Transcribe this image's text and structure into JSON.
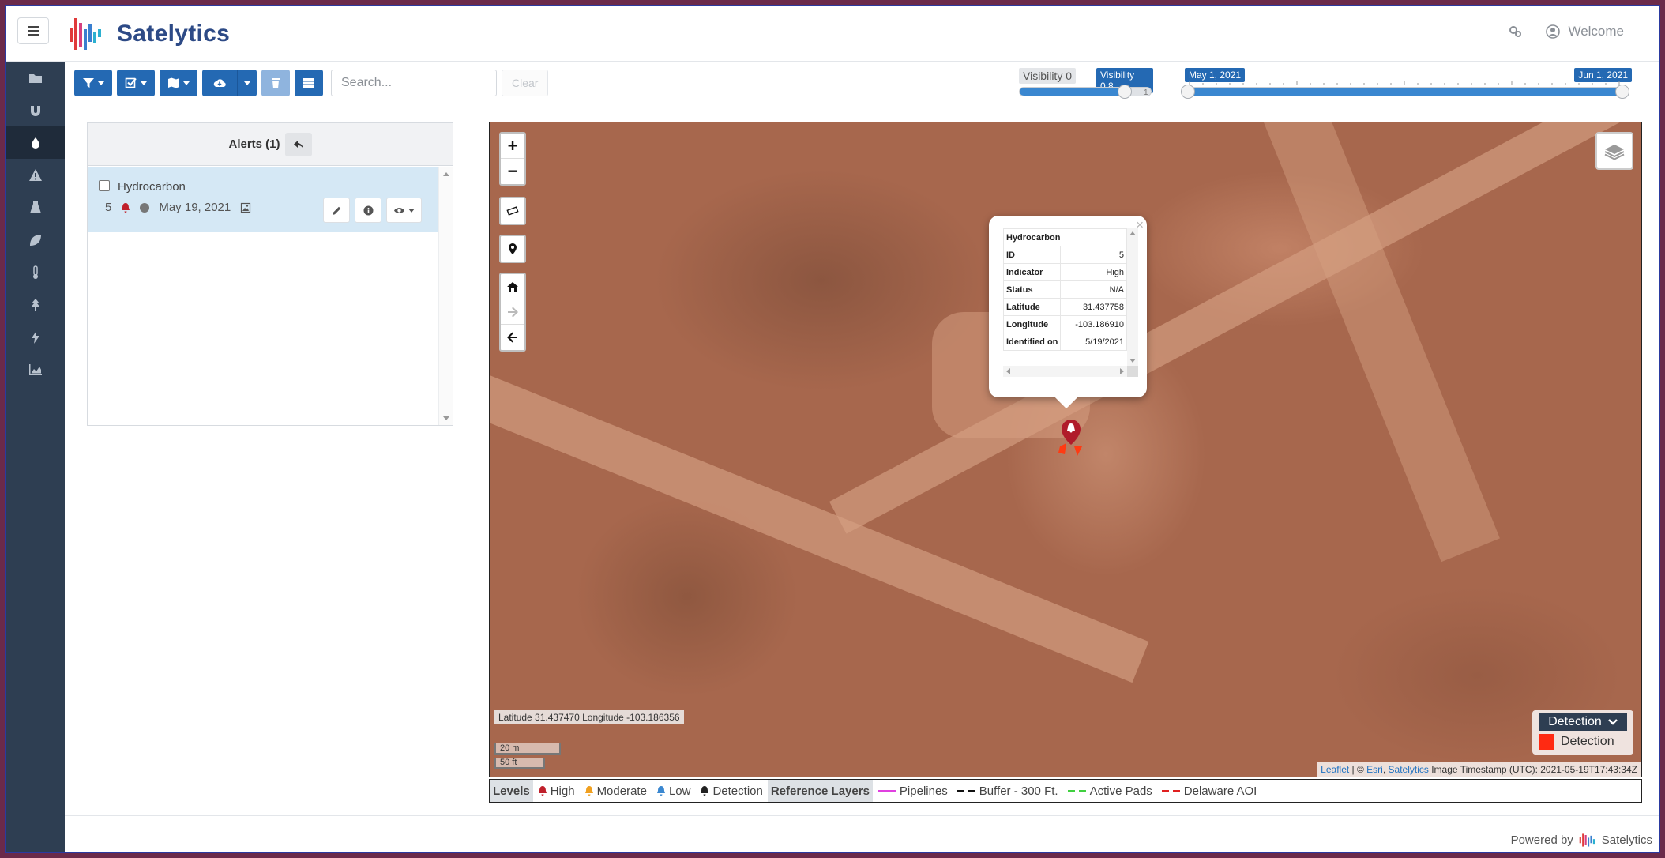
{
  "app": {
    "brand": "Satelytics",
    "welcome": "Welcome"
  },
  "toolbar": {
    "search_placeholder": "Search...",
    "clear_label": "Clear"
  },
  "visibility_slider": {
    "min_label": "Visibility 0",
    "current_label": "Visibility 0.8",
    "max_tick": "1",
    "value": 0.8
  },
  "time_slider": {
    "start_label": "May 1, 2021",
    "end_label": "Jun 1, 2021"
  },
  "alerts_panel": {
    "title": "Alerts (1)",
    "items": [
      {
        "name": "Hydrocarbon",
        "id": "5",
        "date": "May 19, 2021",
        "level": "High"
      }
    ]
  },
  "popup": {
    "title": "Hydrocarbon",
    "rows": [
      {
        "key": "ID",
        "value": "5"
      },
      {
        "key": "Indicator",
        "value": "High"
      },
      {
        "key": "Status",
        "value": "N/A"
      },
      {
        "key": "Latitude",
        "value": "31.437758"
      },
      {
        "key": "Longitude",
        "value": "-103.186910"
      },
      {
        "key": "Identified on",
        "value": "5/19/2021"
      }
    ]
  },
  "map": {
    "coords": "Latitude 31.437470 Longitude -103.186356",
    "scale_metric": "20 m",
    "scale_imperial": "50 ft",
    "legend_title": "Detection",
    "legend_item": "Detection",
    "attribution": {
      "leaflet": "Leaflet",
      "sep": " | © ",
      "esri": "Esri",
      "comma": ", ",
      "satelytics": "Satelytics",
      "timestamp": " Image Timestamp (UTC): 2021-05-19T17:43:34Z"
    }
  },
  "levels_bar": {
    "levels_label": "Levels",
    "high": "High",
    "moderate": "Moderate",
    "low": "Low",
    "detection": "Detection",
    "ref_label": "Reference Layers",
    "pipelines": "Pipelines",
    "buffer": "Buffer - 300 Ft.",
    "active_pads": "Active Pads",
    "delaware": "Delaware AOI"
  },
  "footer": {
    "powered_by": "Powered by",
    "brand": "Satelytics"
  },
  "colors": {
    "accent": "#2469b3",
    "sidebar": "#2e3e52",
    "high": "#c0202b",
    "moderate": "#f0a020",
    "low": "#3a87d0",
    "pipelines": "#e040e0",
    "active_pads": "#40d040",
    "delaware": "#e02020"
  },
  "icons": [
    "bars-icon",
    "gear-users-icon",
    "user-circle-icon",
    "folder-icon",
    "magnet-icon",
    "drop-icon",
    "warning-icon",
    "flask-icon",
    "leaf-icon",
    "thermometer-icon",
    "tree-icon",
    "bolt-icon",
    "area-chart-icon",
    "filter-icon",
    "check-square-icon",
    "map-icon",
    "cloud-download-icon",
    "trash-icon",
    "list-icon",
    "bell-icon",
    "pencil-icon",
    "info-icon",
    "eye-icon",
    "image-icon",
    "layers-icon",
    "ruler-icon",
    "map-pin-icon",
    "home-icon",
    "arrow-right-icon",
    "arrow-left-icon",
    "reply-icon"
  ]
}
